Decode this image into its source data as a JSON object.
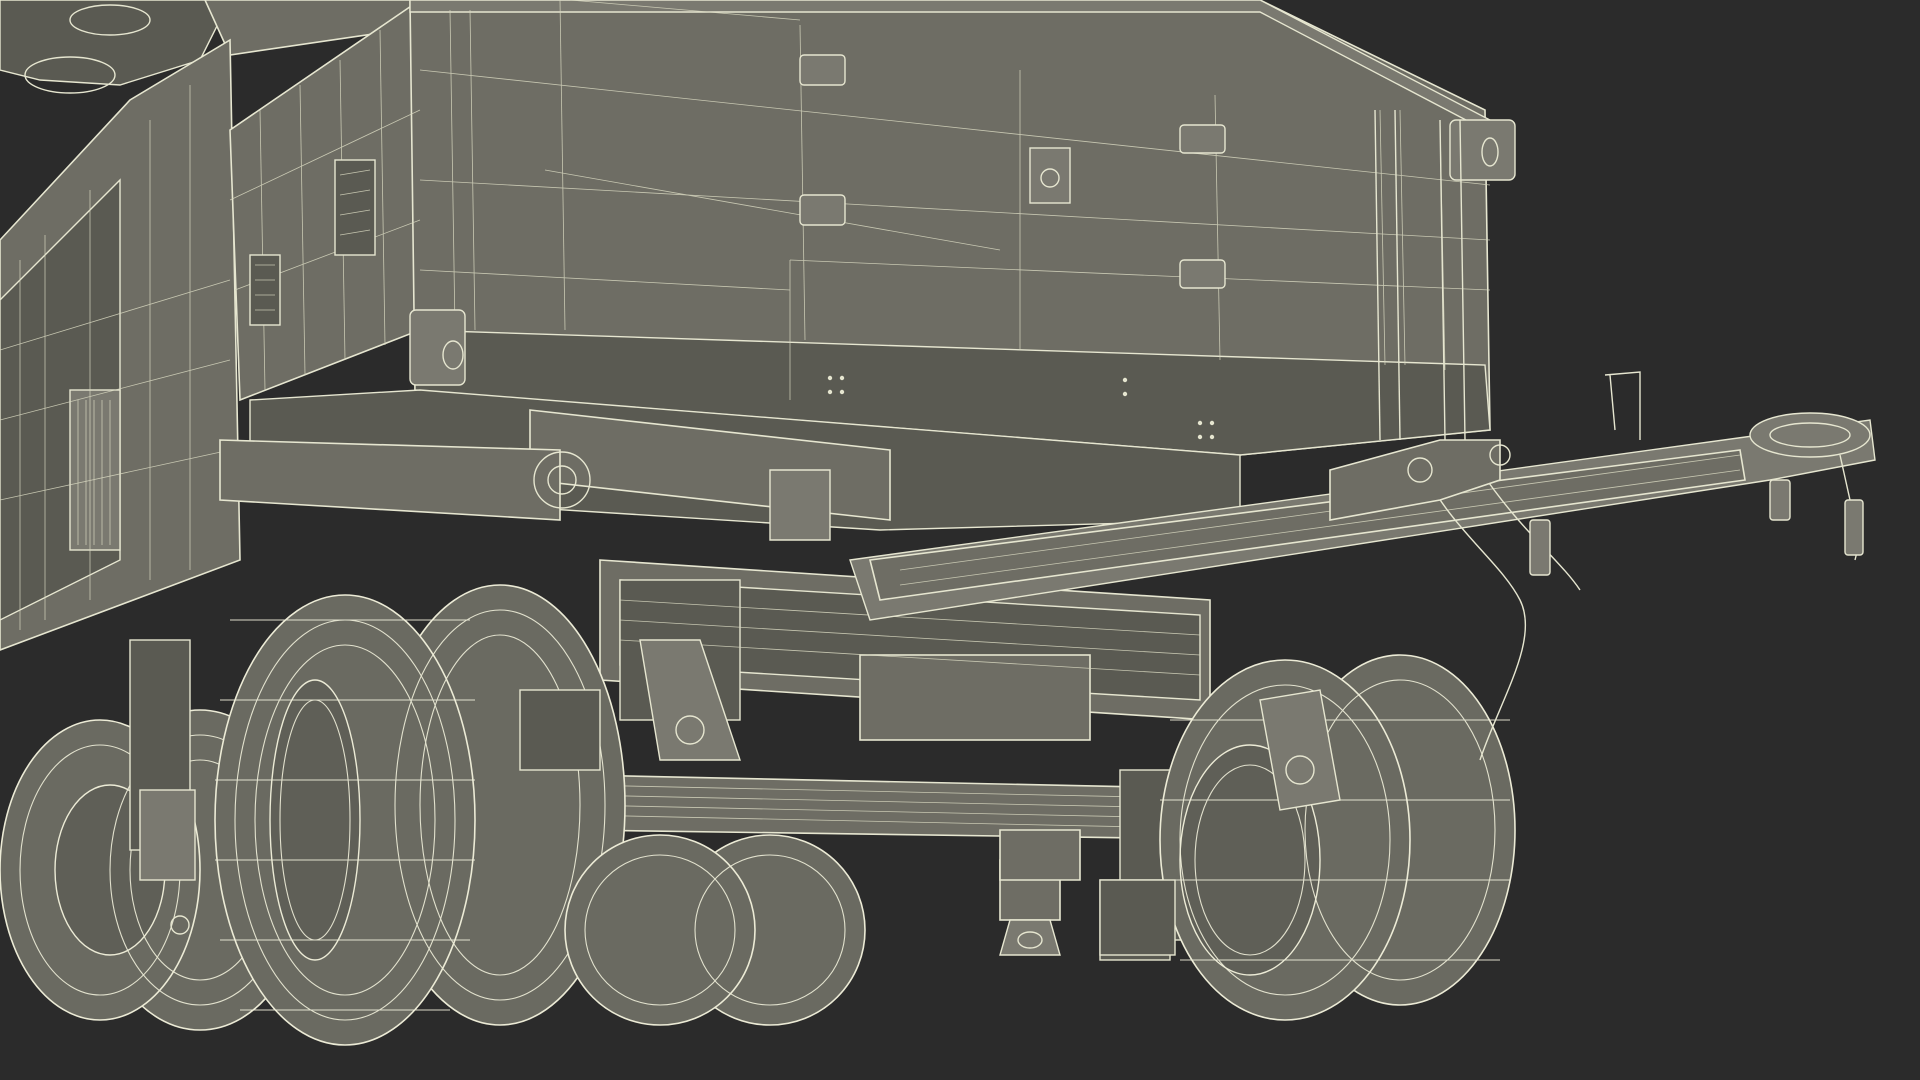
{
  "scene": {
    "background_color": "#2b2b2b",
    "wireframe_color": "#e6e6d0",
    "body_color": "#6e6d64"
  }
}
